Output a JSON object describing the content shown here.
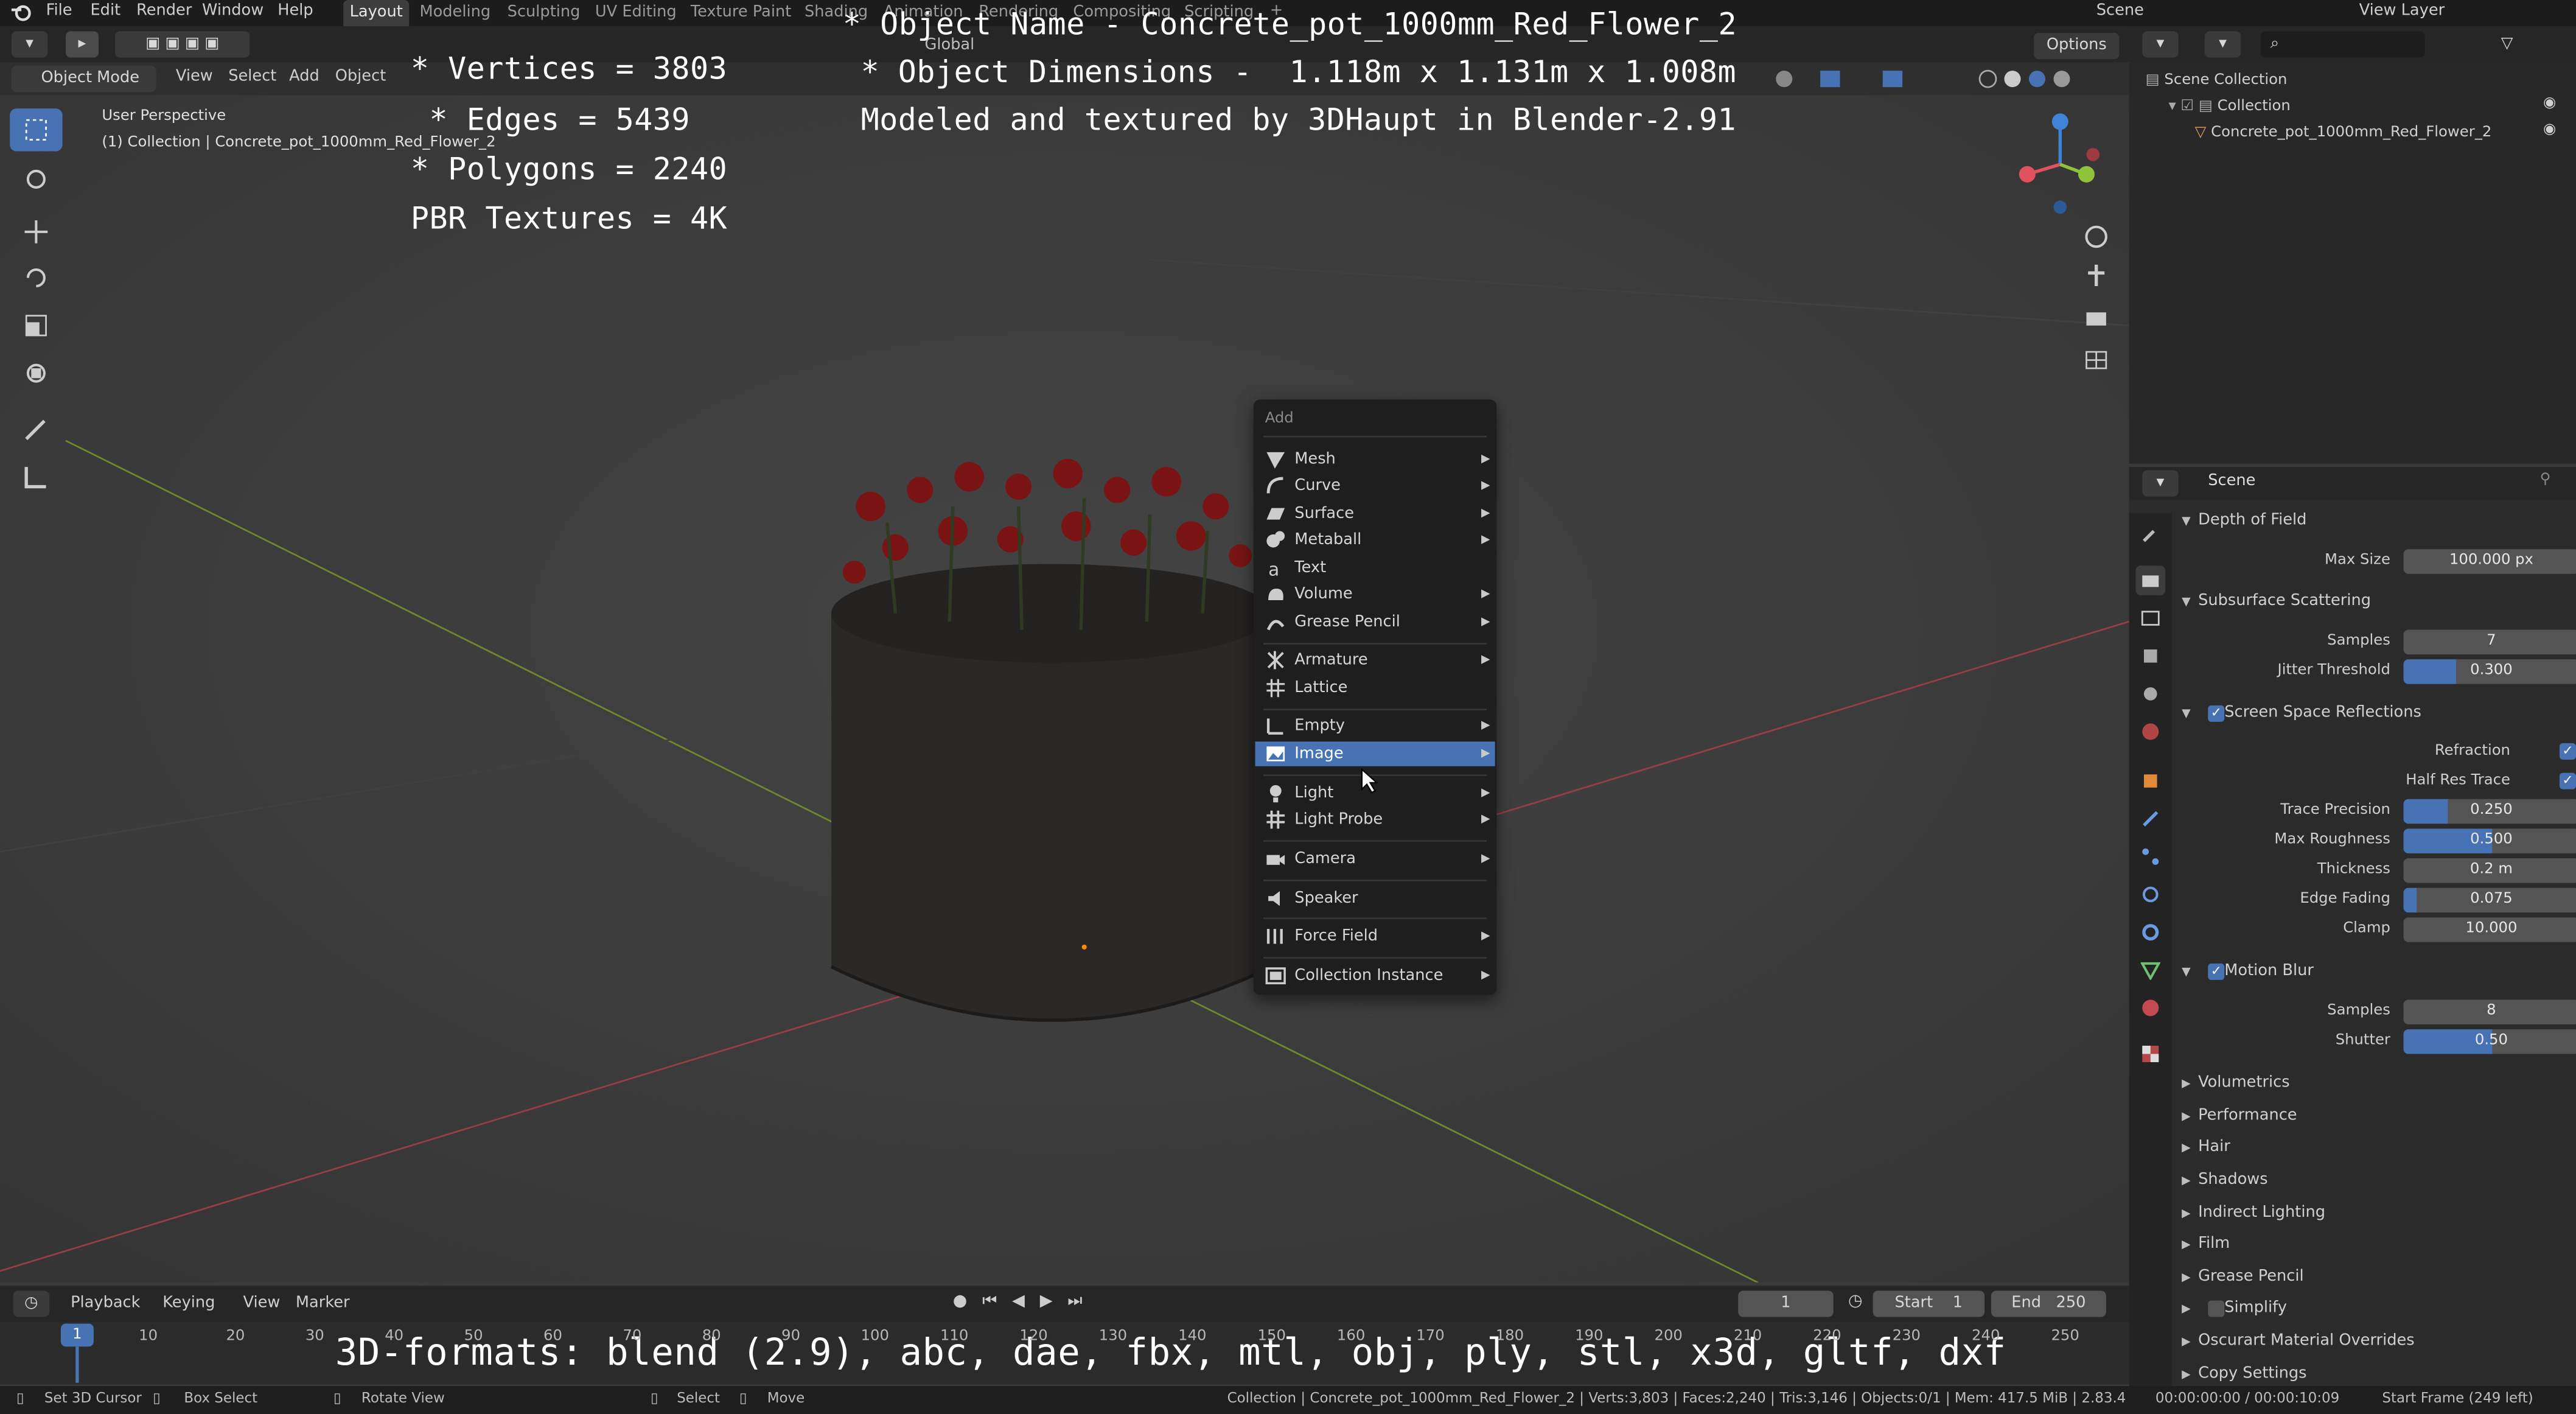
{
  "top_menu": [
    "File",
    "Edit",
    "Render",
    "Window",
    "Help"
  ],
  "workspaces": [
    "Layout",
    "Modeling",
    "Sculpting",
    "UV Editing",
    "Texture Paint",
    "Shading",
    "Animation",
    "Rendering",
    "Compositing",
    "Scripting"
  ],
  "scene_name": "Scene",
  "view_layer": "View Layer",
  "header": {
    "mode": "Object Mode",
    "view": "View",
    "select": "Select",
    "add": "Add",
    "object": "Object",
    "orientation": "Global",
    "options": "Options"
  },
  "viewport": {
    "perspective": "User Perspective",
    "collection_line": "(1) Collection | Concrete_pot_1000mm_Red_Flower_2"
  },
  "overlay": {
    "vertices": "* Vertices = 3803",
    "edges": " * Edges = 5439",
    "polygons": "* Polygons = 2240",
    "textures": "PBR Textures = 4K",
    "object_name": "* Object Name - Concrete_pot_1000mm_Red_Flower_2",
    "dimensions": "* Object Dimensions -  1.118m x 1.131m x 1.008m",
    "modeled_by": "Modeled and textured by 3DHaupt in Blender-2.91",
    "formats": "3D-formats: blend (2.9), abc, dae, fbx, mtl, obj, ply, stl, x3d, gltf, dxf"
  },
  "add_menu": {
    "title": "Add",
    "items": [
      {
        "label": "Mesh",
        "icon": "mesh-icon",
        "sub": true
      },
      {
        "label": "Curve",
        "icon": "curve-icon",
        "sub": true
      },
      {
        "label": "Surface",
        "icon": "surface-icon",
        "sub": true
      },
      {
        "label": "Metaball",
        "icon": "metaball-icon",
        "sub": true
      },
      {
        "label": "Text",
        "icon": "text-icon",
        "sub": false
      },
      {
        "label": "Volume",
        "icon": "volume-icon",
        "sub": true
      },
      {
        "label": "Grease Pencil",
        "icon": "grease-pencil-icon",
        "sub": true
      },
      {
        "label": "Armature",
        "icon": "armature-icon",
        "sub": true
      },
      {
        "label": "Lattice",
        "icon": "lattice-icon",
        "sub": false
      },
      {
        "label": "Empty",
        "icon": "empty-icon",
        "sub": true
      },
      {
        "label": "Image",
        "icon": "image-icon",
        "sub": true,
        "selected": true
      },
      {
        "label": "Light",
        "icon": "light-icon",
        "sub": true
      },
      {
        "label": "Light Probe",
        "icon": "light-probe-icon",
        "sub": true
      },
      {
        "label": "Camera",
        "icon": "camera-icon",
        "sub": true
      },
      {
        "label": "Speaker",
        "icon": "speaker-icon",
        "sub": false
      },
      {
        "label": "Force Field",
        "icon": "force-field-icon",
        "sub": true
      },
      {
        "label": "Collection Instance",
        "icon": "collection-instance-icon",
        "sub": true
      }
    ]
  },
  "outliner": {
    "scene_collection": "Scene Collection",
    "collection": "Collection",
    "object": "Concrete_pot_1000mm_Red_Flower_2"
  },
  "properties": {
    "context": "Scene",
    "dof": {
      "title": "Depth of Field",
      "max_size_label": "Max Size",
      "max_size": "100.000 px"
    },
    "sss": {
      "title": "Subsurface Scattering",
      "samples_label": "Samples",
      "samples": "7",
      "jitter_label": "Jitter Threshold",
      "jitter": "0.300"
    },
    "ssr": {
      "title": "Screen Space Reflections",
      "refraction": "Refraction",
      "half_res": "Half Res Trace",
      "fields": [
        {
          "label": "Trace Precision",
          "value": "0.250",
          "fill": 0.25
        },
        {
          "label": "Max Roughness",
          "value": "0.500",
          "fill": 0.5
        },
        {
          "label": "Thickness",
          "value": "0.2 m",
          "fill": 0
        },
        {
          "label": "Edge Fading",
          "value": "0.075",
          "fill": 0.075
        },
        {
          "label": "Clamp",
          "value": "10.000",
          "fill": 0
        }
      ]
    },
    "motion_blur": {
      "title": "Motion Blur",
      "samples_label": "Samples",
      "samples": "8",
      "shutter_label": "Shutter",
      "shutter": "0.50"
    },
    "collapsed": [
      "Volumetrics",
      "Performance",
      "Hair",
      "Shadows",
      "Indirect Lighting",
      "Film",
      "Grease Pencil",
      "Simplify",
      "Oscurart Material Overrides",
      "Copy Settings"
    ]
  },
  "timeline": {
    "playback": "Playback",
    "keying": "Keying",
    "view": "View",
    "marker": "Marker",
    "current_frame": "1",
    "start_label": "Start",
    "start": "1",
    "end_label": "End",
    "end": "250",
    "ticks": [
      "1",
      "10",
      "20",
      "30",
      "40",
      "50",
      "60",
      "70",
      "80",
      "90",
      "100",
      "110",
      "120",
      "130",
      "140",
      "150",
      "160",
      "170",
      "180",
      "190",
      "200",
      "210",
      "220",
      "230",
      "240",
      "250"
    ]
  },
  "status": {
    "set_cursor": "Set 3D Cursor",
    "box_select": "Box Select",
    "rotate_view": "Rotate View",
    "select": "Select",
    "move": "Move",
    "info": "Collection | Concrete_pot_1000mm_Red_Flower_2 | Verts:3,803 | Faces:2,240 | Tris:3,146 | Objects:0/1 | Mem: 417.5 MiB | 2.83.4",
    "time": "00:00:00:00 / 00:00:10:09",
    "start_frame": "Start Frame (249 left)"
  },
  "colors": {
    "accent": "#4772b3",
    "x_axis": "#e0525c",
    "y_axis": "#8fc43a",
    "z_axis": "#3f83d8"
  }
}
